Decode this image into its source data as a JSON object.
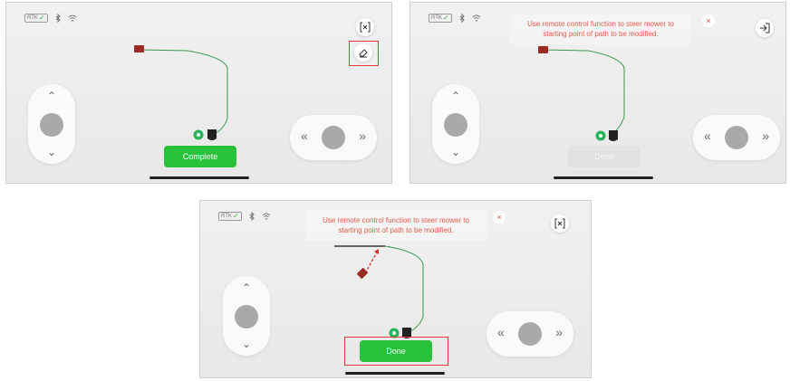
{
  "status": {
    "rtk_label": "RTK",
    "rtk_check_icon": "check-icon",
    "bluetooth_icon": "bluetooth-icon",
    "wifi_icon": "wifi-icon"
  },
  "panel1": {
    "exit_icon": "exit-frame-icon",
    "erase_icon": "eraser-icon",
    "action_label": "Complete",
    "highlight_color": "#e03a3a"
  },
  "panel2": {
    "notice_line1": "Use remote control function to steer mower to",
    "notice_line2": "starting point of path to be modified.",
    "close_label": "×",
    "exit_icon": "logout-icon",
    "action_label": "Done"
  },
  "panel3": {
    "notice_line1": "Use remote control function to steer mower to",
    "notice_line2": "starting point of path to be modified.",
    "close_label": "×",
    "exit_icon": "exit-frame-icon",
    "action_label": "Done"
  },
  "controls": {
    "up": "⌃",
    "down": "⌄",
    "left": "«",
    "right": "»"
  },
  "colors": {
    "accent_green": "#27c13a",
    "path_green": "#3a9a4e",
    "notice_red": "#e25b4b"
  }
}
